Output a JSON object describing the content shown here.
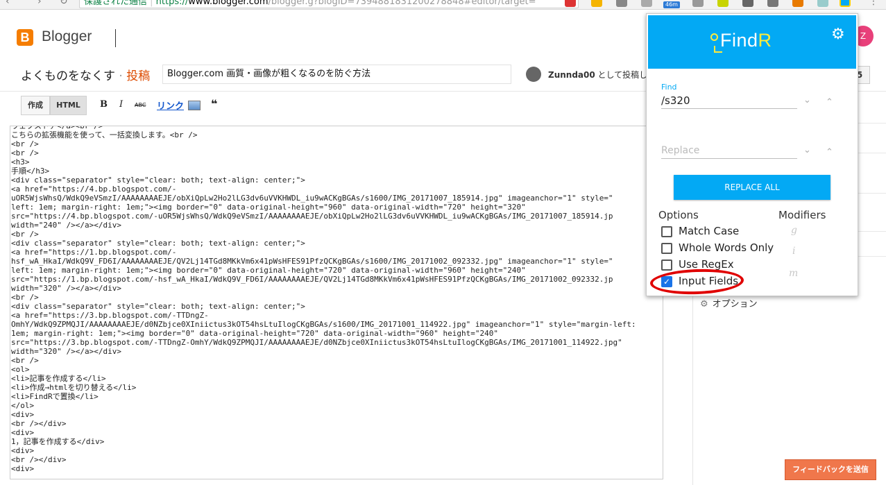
{
  "browser": {
    "secure_label": "保護された通信",
    "url_proto": "https://",
    "url_host": "www.blogger.com",
    "url_path": "/blogger.g?blogID=7394881831200278848#editor/target=",
    "badge": "46m"
  },
  "header": {
    "logo_letter": "B",
    "app_name": "Blogger",
    "avatar_letter": "Z"
  },
  "post": {
    "blog_name": "よくものをなくす",
    "separator": "·",
    "post_label": "投稿",
    "title_value": "Blogger.com 画質・画像が粗くなるのを防ぐ方法",
    "author": "Zunnda00",
    "author_suffix": "として投稿して",
    "right_btn": "5"
  },
  "toolbar": {
    "compose": "作成",
    "html": "HTML",
    "bold": "B",
    "italic": "I",
    "strike": "ABC",
    "link": "リンク",
    "quote": "❝"
  },
  "editor": {
    "lines": [
      "ウェブストア</a><br />",
      "こちらの拡張機能を使って、一括変換します。<br />",
      "<br />",
      "<br />",
      "<h3>",
      "手順</h3>",
      "<div class=\"separator\" style=\"clear: both; text-align: center;\">",
      "<a href=\"https://4.bp.blogspot.com/-",
      "uOR5WjsWhsQ/WdkQ9eVSmzI/AAAAAAAAEJE/obXiQpLw2Ho2lLG3dv6uVVKHWDL_iu9wACKgBGAs/s1600/IMG_20171007_185914.jpg\" imageanchor=\"1\" style=\"",
      "left: 1em; margin-right: 1em;\"><img border=\"0\" data-original-height=\"960\" data-original-width=\"720\" height=\"320\"",
      "src=\"https://4.bp.blogspot.com/-uOR5WjsWhsQ/WdkQ9eVSmzI/AAAAAAAAEJE/obXiQpLw2Ho2lLG3dv6uVVKHWDL_iu9wACKgBGAs/IMG_20171007_185914.jp",
      "width=\"240\" /></a></div>",
      "<br />",
      "<div class=\"separator\" style=\"clear: both; text-align: center;\">",
      "<a href=\"https://1.bp.blogspot.com/-",
      "hsf_wA_HkaI/WdkQ9V_FD6I/AAAAAAAAEJE/QV2Lj14TGd8MKkVm6x41pWsHFES91PfzQCKgBGAs/s1600/IMG_20171002_092332.jpg\" imageanchor=\"1\" style=\"",
      "left: 1em; margin-right: 1em;\"><img border=\"0\" data-original-height=\"720\" data-original-width=\"960\" height=\"240\"",
      "src=\"https://1.bp.blogspot.com/-hsf_wA_HkaI/WdkQ9V_FD6I/AAAAAAAAEJE/QV2Lj14TGd8MKkVm6x41pWsHFES91PfzQCKgBGAs/IMG_20171002_092332.jp",
      "width=\"320\" /></a></div>",
      "<br />",
      "<div class=\"separator\" style=\"clear: both; text-align: center;\">",
      "<a href=\"https://3.bp.blogspot.com/-TTDngZ-",
      "OmhY/WdkQ9ZPMQJI/AAAAAAAAEJE/d0NZbjce0XIniictus3kOT54hsLtuIlogCKgBGAs/s1600/IMG_20171001_114922.jpg\" imageanchor=\"1\" style=\"margin-left:",
      "1em; margin-right: 1em;\"><img border=\"0\" data-original-height=\"720\" data-original-width=\"960\" height=\"240\"",
      "src=\"https://3.bp.blogspot.com/-TTDngZ-OmhY/WdkQ9ZPMQJI/AAAAAAAAEJE/d0NZbjce0XIniictus3kOT54hsLtuIlogCKgBGAs/IMG_20171001_114922.jpg\"",
      "width=\"320\" /></a></div>",
      "<br />",
      "<ol>",
      "<li>記事を作成する</li>",
      "<li>作成→htmlを切り替える</li>",
      "<li>FindRで置換</li>",
      "</ol>",
      "<div>",
      "<br /></div>",
      "<div>",
      "1，記事を作成する</div>",
      "<div>",
      "<br /></div>",
      "<div>"
    ]
  },
  "sidebar": {
    "options_label": "オプション",
    "feedback": "フィードバックを送信"
  },
  "findr": {
    "logo_main": "FindR",
    "find_label": "Find",
    "find_value": "/s320",
    "replace_placeholder": "Replace",
    "replace_all": "REPLACE ALL",
    "options_title": "Options",
    "modifiers_title": "Modifiers",
    "options": [
      {
        "label": "Match Case",
        "checked": false,
        "modifier": "g"
      },
      {
        "label": "Whole Words Only",
        "checked": false,
        "modifier": "i"
      },
      {
        "label": "Use RegEx",
        "checked": false,
        "modifier": "m"
      },
      {
        "label": "Input Fields",
        "checked": true,
        "modifier": ""
      }
    ],
    "check_mark": "✓",
    "accent": "#03a9f4"
  }
}
